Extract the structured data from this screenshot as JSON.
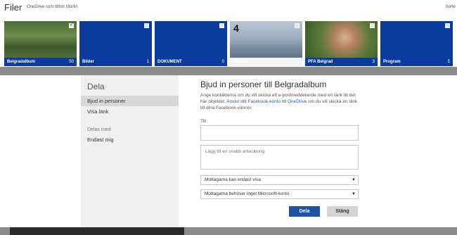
{
  "header": {
    "app_title": "Filer",
    "subtitle": "OneDrive som tillhör Martin",
    "sort_label": "Sorte"
  },
  "tiles": [
    {
      "name": "Belgradalbum",
      "count": "50"
    },
    {
      "name": "Bilder",
      "count": "1"
    },
    {
      "name": "DOKUMENT",
      "count": "0"
    },
    {
      "name": "Finland",
      "count": "1",
      "badge": "4"
    },
    {
      "name": "PFA Belgrad",
      "count": "3"
    },
    {
      "name": "Program",
      "count": "5"
    }
  ],
  "side": {
    "title": "Dela",
    "items": [
      "Bjud in personer",
      "Visa länk"
    ],
    "group_label": "Delas med",
    "group_items": [
      "Endast mig"
    ]
  },
  "dialog": {
    "title": "Bjud in personer till Belgradalbum",
    "desc_before": "Ange kontakterna om du vill skicka ett e-postmeddelande med en länk till det här objektet. ",
    "desc_link": "Anslut ditt Facebook-konto till OneDrive",
    "desc_after": " om du vill skicka en länk till dina Facebook-vänner.",
    "to_label": "Till",
    "to_value": "",
    "note_placeholder": "Lägg till en snabb anteckning",
    "permission_select": "Mottagarna kan endast visa",
    "account_select": "Mottagarna behöver inget Microsoft-konto",
    "share_button": "Dela",
    "close_button": "Stäng"
  }
}
